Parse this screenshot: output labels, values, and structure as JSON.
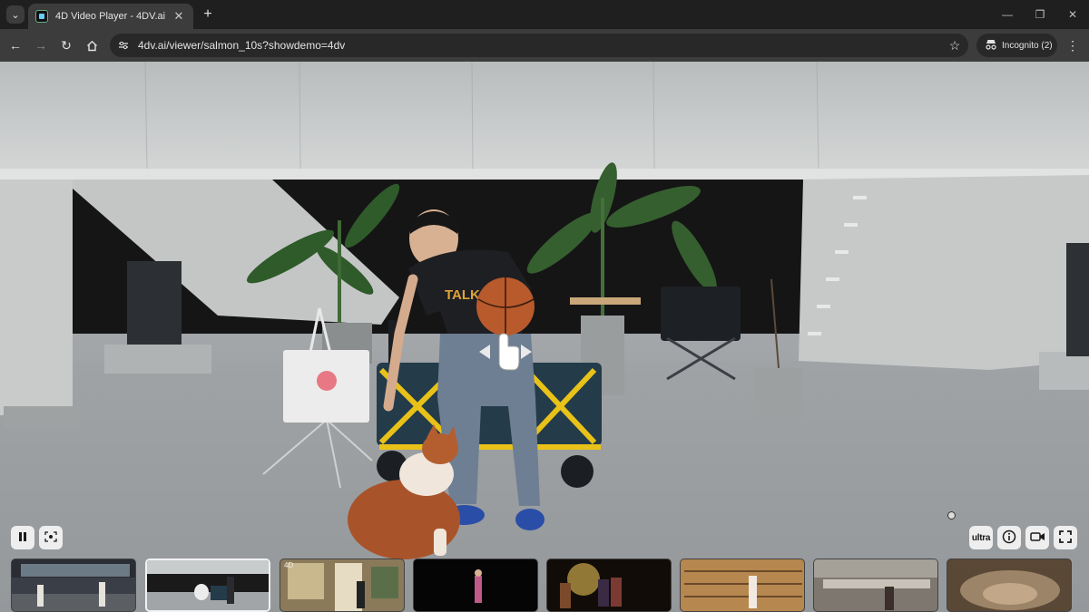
{
  "browser": {
    "tab_title": "4D Video Player - 4DV.ai",
    "url": "4dv.ai/viewer/salmon_10s?showdemo=4dv",
    "incognito_label": "Incognito (2)",
    "icons": {
      "tab_search": "chevron-down-icon",
      "close_tab": "close-icon",
      "new_tab": "plus-icon",
      "back": "arrow-left-icon",
      "forward": "arrow-right-icon",
      "reload": "reload-icon",
      "home": "home-icon",
      "site_info": "tune-icon",
      "bookmark": "star-icon",
      "incognito": "incognito-icon",
      "menu": "kebab-menu-icon"
    }
  },
  "player": {
    "quality_label": "ultra",
    "state": "playing",
    "icons": [
      "pause-icon",
      "recenter-icon",
      "info-icon",
      "video-camera-icon",
      "fullscreen-icon",
      "drag-hand-icon"
    ]
  },
  "thumbnails": {
    "active_index": 1,
    "items": [
      {
        "name": "warehouse-scene"
      },
      {
        "name": "basketball-dog-scene"
      },
      {
        "name": "room-scene",
        "caption": "4D"
      },
      {
        "name": "dancer-scene"
      },
      {
        "name": "band-scene"
      },
      {
        "name": "library-scene"
      },
      {
        "name": "stone-ruins-scene"
      },
      {
        "name": "cave-scene"
      }
    ]
  },
  "colors": {
    "chrome_bg": "#1f1f1f",
    "toolbar_bg": "#3c3c3c",
    "control_bg": "#f5f5f5"
  }
}
